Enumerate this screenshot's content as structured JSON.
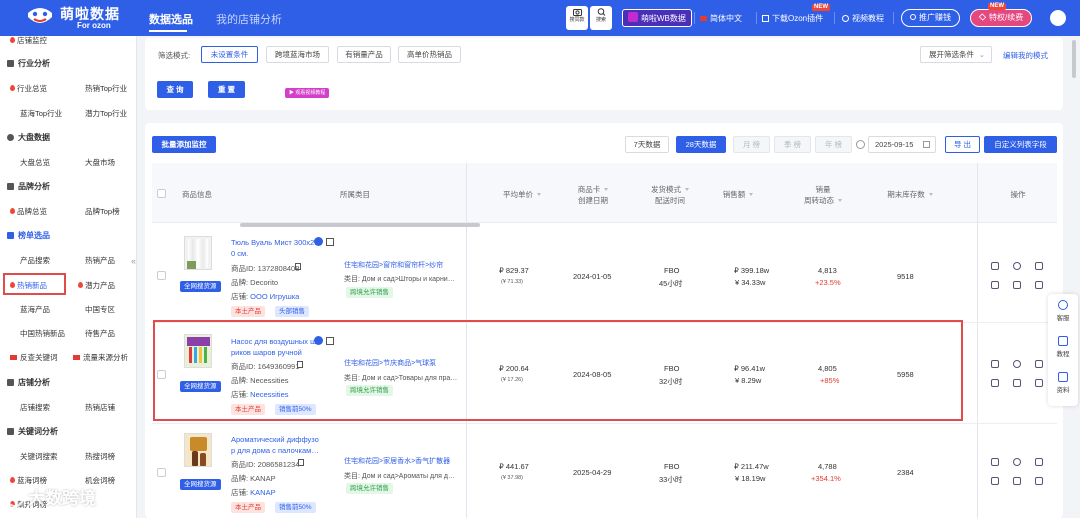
{
  "brand": {
    "name_cn": "萌啦数据",
    "name_en": "For ozon"
  },
  "nav": {
    "main": "数据选品",
    "second": "我的店铺分析"
  },
  "toolbar": {
    "icon1_label": "搜同款",
    "icon2_label": "搜索",
    "wb": "萌啦WB数据",
    "lang": "简体中文",
    "download": "下载Ozon插件",
    "download_badge": "NEW",
    "tutorial": "视频教程",
    "promo": "推广赚钱",
    "vip": "特权/续费",
    "vip_badge": "NEW"
  },
  "sidebar": {
    "top_item": "店铺监控",
    "sections": [
      {
        "title": "行业分析",
        "items": [
          "行业总览",
          "热销Top行业",
          "蓝海Top行业",
          "潜力Top行业"
        ]
      },
      {
        "title": "大盘数据",
        "items": [
          "大盘总览",
          "大盘市场"
        ]
      },
      {
        "title": "品牌分析",
        "items": [
          "品牌总览",
          "品牌Top榜"
        ]
      },
      {
        "title": "榜单选品",
        "items": [
          "产品搜索",
          "热销产品",
          "热销新品",
          "潜力产品",
          "蓝海产品",
          "中国专区",
          "中国热销新品",
          "待售产品",
          "反查关键词",
          "流量来源分析"
        ]
      },
      {
        "title": "店铺分析",
        "items": [
          "店铺搜索",
          "热销店铺"
        ]
      },
      {
        "title": "关键词分析",
        "items": [
          "关键词搜索",
          "热搜词榜",
          "蓝海词榜",
          "机会词榜",
          "飙升词榜"
        ]
      }
    ]
  },
  "filter": {
    "mode_label": "筛选模式:",
    "modes": [
      "未设置条件",
      "跨境蓝海市场",
      "有销量产品",
      "高单价热销品"
    ],
    "expand": "展开筛选条件",
    "edit_mode": "编辑我的模式",
    "query": "查 询",
    "reset": "重 置",
    "video": "观看视频教程"
  },
  "table_toolbar": {
    "batch": "批量添加监控",
    "ranges": [
      "7天数据",
      "28天数据",
      "月 榜",
      "季 榜",
      "年 榜"
    ],
    "date": "2025-09-15",
    "export": "导 出",
    "custom": "自定义列表字段"
  },
  "columns": {
    "product": "商品信息",
    "category": "所属类目",
    "price": "平均单价",
    "created_a": "商品卡",
    "created_b": "创建日期",
    "ship_a": "发货模式",
    "ship_b": "配送时间",
    "sales": "销售额",
    "vol_a": "销量",
    "vol_b": "周转动态",
    "stock": "期末库存数",
    "ops": "操作"
  },
  "rows": [
    {
      "title_a": "Тюль Вуаль Мист 300x25",
      "title_b": "0 см.",
      "id": "商品ID: 1372808408",
      "brand": "品牌: Decorito",
      "store_label": "店铺: ",
      "store": "ООО Игрушка",
      "tags": [
        "本土产品",
        "头部销售"
      ],
      "source": "全网搜货源",
      "cat_path": "住宅和花园>窗帘和窗帘杆>纱帘",
      "cat_ru": "类目: Дом и сад>Шторы и карни…",
      "cross": "跨境允许销售",
      "price": "₽ 829.37",
      "price_sub": "(¥ 71.33)",
      "date": "2024-01-05",
      "ship": "FBO",
      "ship_time": "45小时",
      "sales": "₽ 399.18w",
      "sales_cny": "¥ 34.33w",
      "vol": "4,813",
      "vol_chg": "+23.5%",
      "stock": "9518"
    },
    {
      "title_a": "Насос для воздушных ша",
      "title_b": "риков шаров ручной",
      "id": "商品ID: 1649360991",
      "brand": "品牌: Necessities",
      "store_label": "店铺: ",
      "store": "Necessities",
      "tags": [
        "本土产品",
        "销售前50%"
      ],
      "source": "全网搜货源",
      "cat_path": "住宅和花园>节庆商品>气球泵",
      "cat_ru": "类目: Дом и сад>Товары для пра…",
      "cross": "跨境允许销售",
      "price": "₽ 200.64",
      "price_sub": "(¥ 17.26)",
      "date": "2024-08-05",
      "ship": "FBO",
      "ship_time": "32小时",
      "sales": "₽ 96.41w",
      "sales_cny": "¥ 8.29w",
      "vol": "4,805",
      "vol_chg": "+85%",
      "stock": "5958"
    },
    {
      "title_a": "Ароматический диффузо",
      "title_b": "р для дома с палочкам…",
      "id": "商品ID: 2086581234",
      "brand": "品牌: KANAP",
      "store_label": "店铺: ",
      "store": "KANAP",
      "tags": [
        "本土产品",
        "销售前50%"
      ],
      "source": "全网搜货源",
      "cat_path": "住宅和花园>家居香水>香气扩散器",
      "cat_ru": "类目: Дом и сад>Ароматы для д…",
      "cross": "跨境允许销售",
      "price": "₽ 441.67",
      "price_sub": "(¥ 37.98)",
      "date": "2025-04-29",
      "ship": "FBO",
      "ship_time": "33小时",
      "sales": "₽ 211.47w",
      "sales_cny": "¥ 18.19w",
      "vol": "4,788",
      "vol_chg": "+354.1%",
      "stock": "2384"
    }
  ],
  "float": {
    "service": "客服",
    "tutorial": "教程",
    "docs": "资料"
  },
  "watermark": "大数跨境",
  "colors": {
    "primary": "#2f5fe7",
    "accent_red": "#e23c32",
    "highlight_border": "#e04b4b"
  }
}
